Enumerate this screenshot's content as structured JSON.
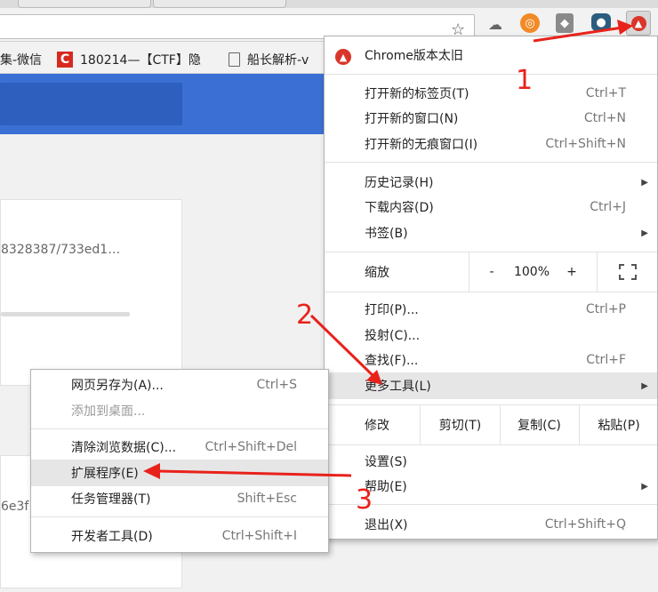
{
  "toolbar": {
    "star_icon": "star-icon",
    "extensions": [
      "cloud-sync-icon",
      "orange-circle-icon",
      "diamond-icon",
      "bear-icon",
      "update-warning-icon"
    ]
  },
  "bookmarks": [
    {
      "label": "集-微信",
      "icon": "none"
    },
    {
      "label": "180214—【CTF】隐",
      "icon": "csdn-icon"
    },
    {
      "label": "船长解析-v",
      "icon": "page-icon"
    }
  ],
  "page": {
    "card1_hash": "8328387/733ed1…",
    "card1_progress": 0.7,
    "card2_fragment": "6e3f"
  },
  "main_menu": {
    "header": "Chrome版本太旧",
    "items": [
      {
        "label": "打开新的标签页(T)",
        "shortcut": "Ctrl+T"
      },
      {
        "label": "打开新的窗口(N)",
        "shortcut": "Ctrl+N"
      },
      {
        "label": "打开新的无痕窗口(I)",
        "shortcut": "Ctrl+Shift+N"
      },
      {
        "label": "历史记录(H)",
        "shortcut": ""
      },
      {
        "label": "下载内容(D)",
        "shortcut": "Ctrl+J"
      },
      {
        "label": "书签(B)",
        "shortcut": ""
      },
      {
        "label": "打印(P)...",
        "shortcut": "Ctrl+P"
      },
      {
        "label": "投射(C)...",
        "shortcut": ""
      },
      {
        "label": "查找(F)...",
        "shortcut": "Ctrl+F"
      },
      {
        "label": "更多工具(L)",
        "shortcut": ""
      },
      {
        "label": "设置(S)",
        "shortcut": ""
      },
      {
        "label": "帮助(E)",
        "shortcut": ""
      },
      {
        "label": "退出(X)",
        "shortcut": "Ctrl+Shift+Q"
      }
    ],
    "zoom": {
      "label": "缩放",
      "minus": "-",
      "value": "100%",
      "plus": "+"
    },
    "edit": {
      "label": "修改",
      "cut": "剪切(T)",
      "copy": "复制(C)",
      "paste": "粘贴(P)"
    }
  },
  "sub_menu": {
    "items": [
      {
        "label": "网页另存为(A)...",
        "shortcut": "Ctrl+S"
      },
      {
        "label": "添加到桌面...",
        "shortcut": ""
      },
      {
        "label": "清除浏览数据(C)...",
        "shortcut": "Ctrl+Shift+Del"
      },
      {
        "label": "扩展程序(E)",
        "shortcut": ""
      },
      {
        "label": "任务管理器(T)",
        "shortcut": "Shift+Esc"
      },
      {
        "label": "开发者工具(D)",
        "shortcut": "Ctrl+Shift+I"
      }
    ]
  },
  "annotations": {
    "step1": "1",
    "step2": "2",
    "step3": "3",
    "arrow_color": "#e8221b"
  }
}
